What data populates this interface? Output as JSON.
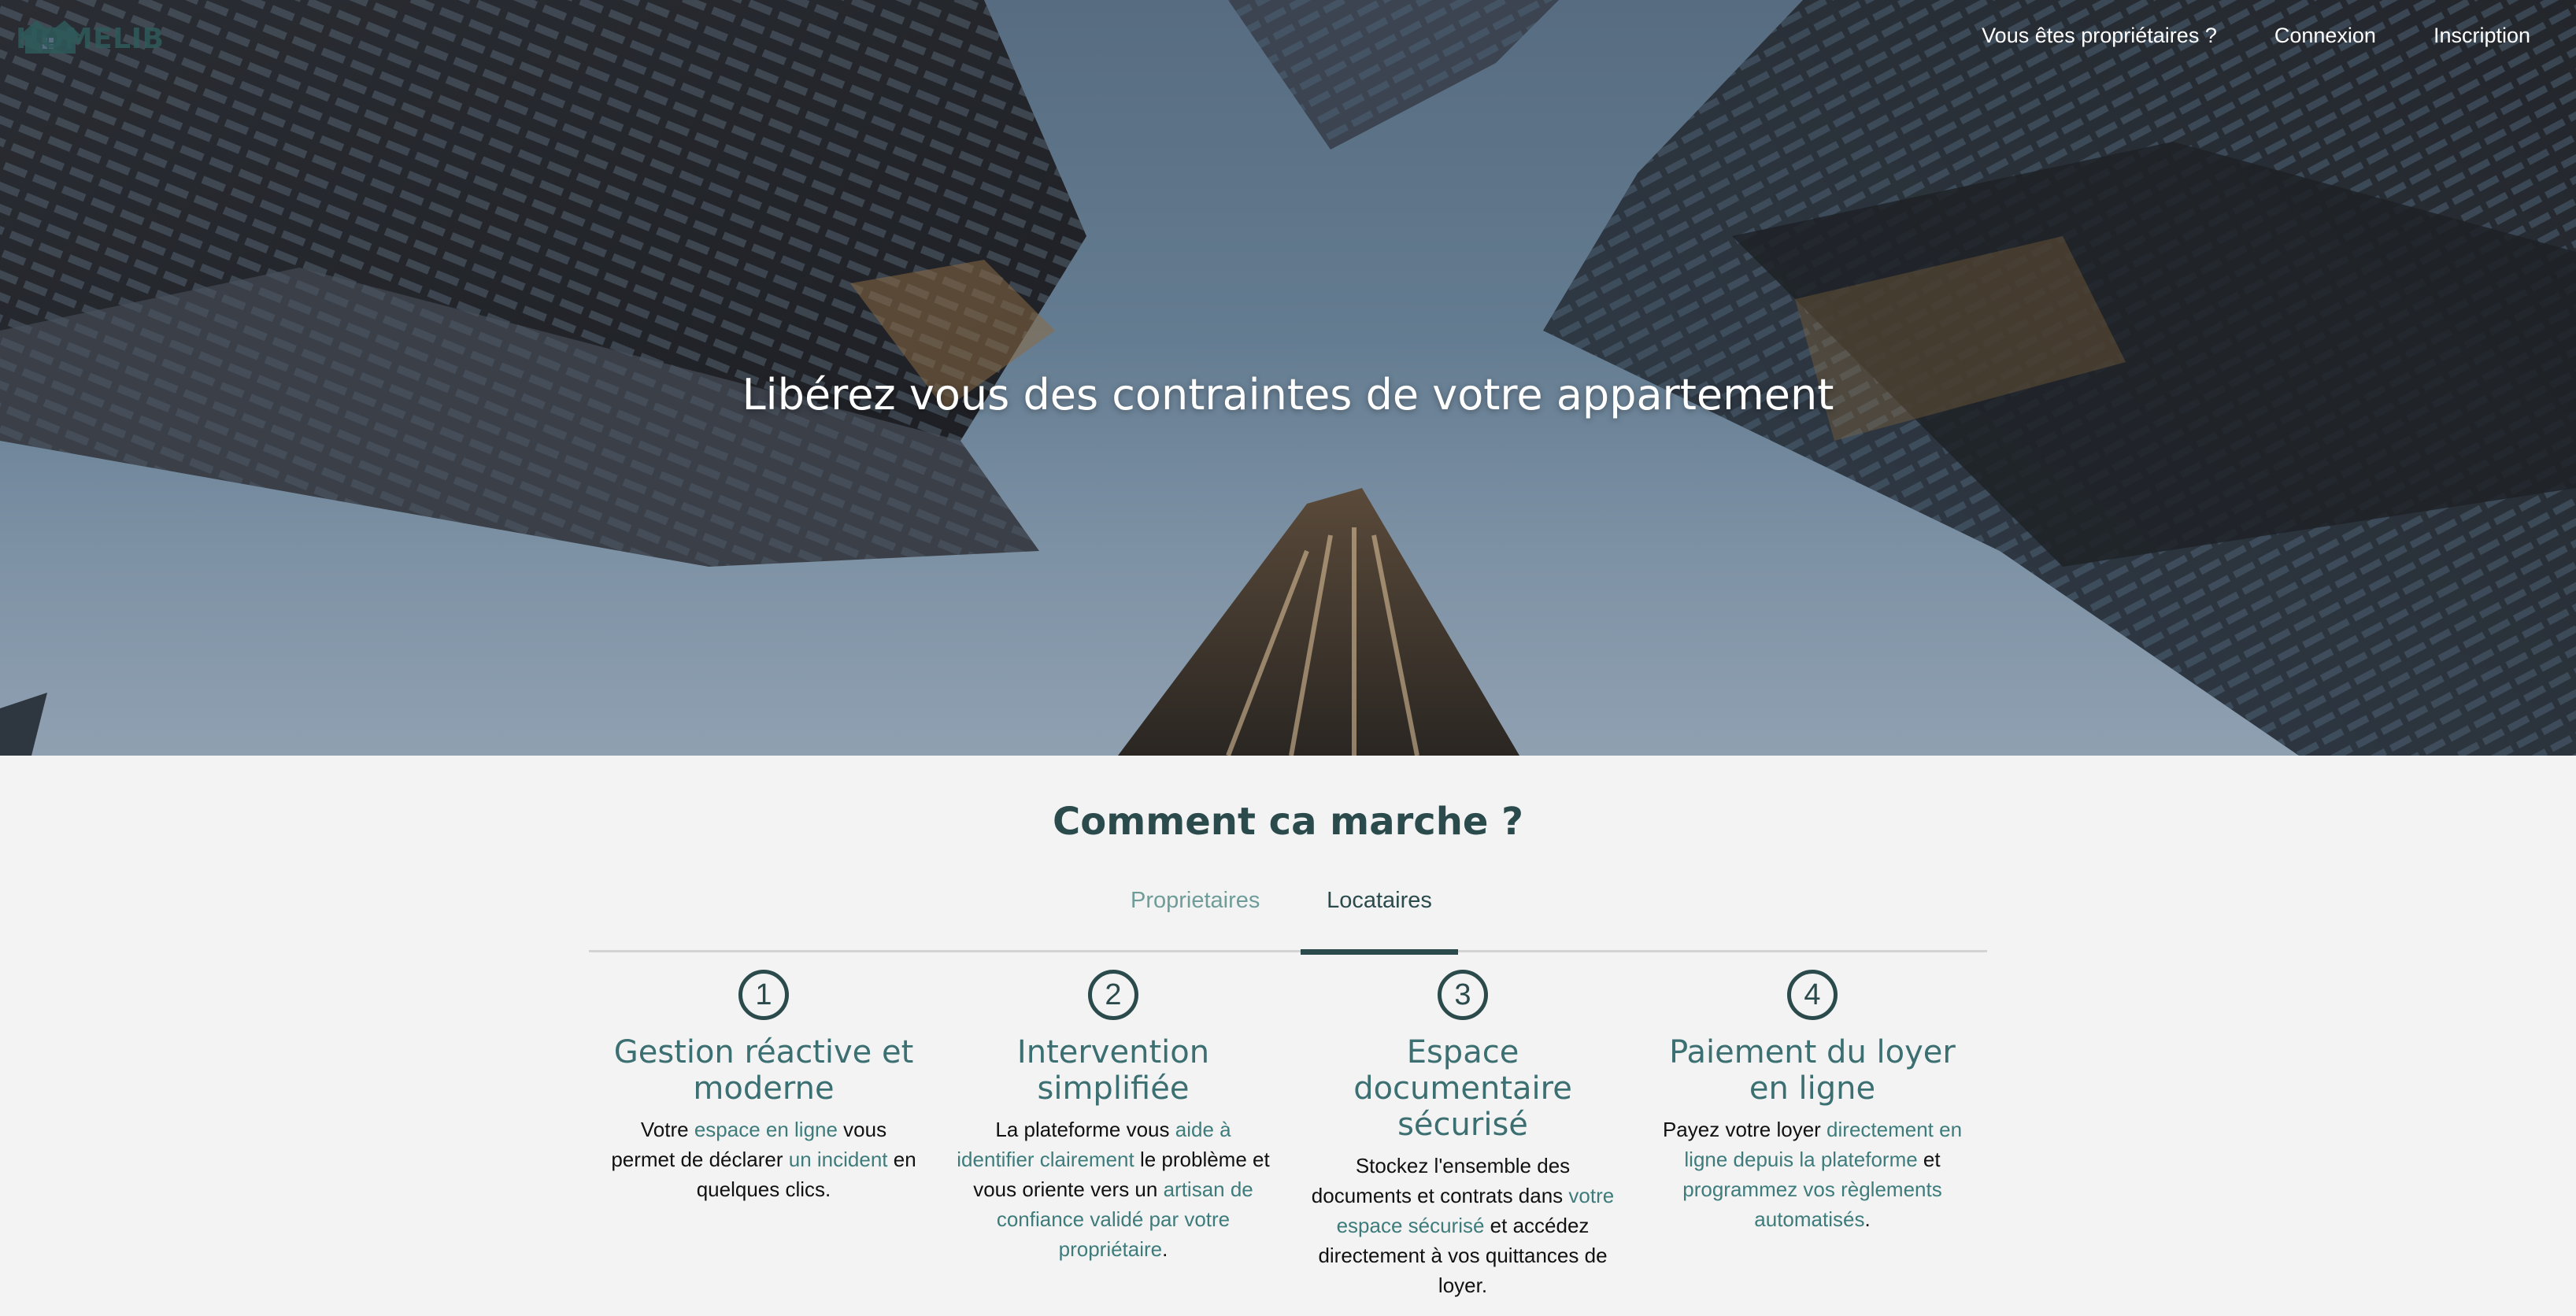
{
  "brand": {
    "name": "HOMELIB"
  },
  "nav": {
    "owners_link": "Vous êtes propriétaires ?",
    "login": "Connexion",
    "signup": "Inscription"
  },
  "hero": {
    "title": "Libérez vous des contraintes de votre appartement"
  },
  "how": {
    "title": "Comment ca marche ?",
    "tabs": [
      {
        "label": "Proprietaires",
        "active": false
      },
      {
        "label": "Locataires",
        "active": true
      }
    ],
    "steps": [
      {
        "number": "1",
        "title": "Gestion réactive et moderne",
        "desc": [
          {
            "t": "Votre "
          },
          {
            "t": "espace en ligne",
            "hl": true
          },
          {
            "t": " vous permet de déclarer "
          },
          {
            "t": "un incident",
            "hl": true
          },
          {
            "t": " en quelques clics."
          }
        ]
      },
      {
        "number": "2",
        "title": "Intervention simplifiée",
        "desc": [
          {
            "t": "La plateforme vous "
          },
          {
            "t": "aide à identifier clairement",
            "hl": true
          },
          {
            "t": " le problème et vous oriente vers un "
          },
          {
            "t": "artisan de confiance validé par votre propriétaire",
            "hl": true
          },
          {
            "t": "."
          }
        ]
      },
      {
        "number": "3",
        "title": "Espace documentaire sécurisé",
        "desc": [
          {
            "t": "Stockez l'ensemble des documents et contrats dans "
          },
          {
            "t": "votre espace sécurisé",
            "hl": true
          },
          {
            "t": " et accédez directement à vos quittances de loyer."
          }
        ]
      },
      {
        "number": "4",
        "title": "Paiement du loyer en ligne",
        "desc": [
          {
            "t": "Payez votre loyer "
          },
          {
            "t": "directement en ligne depuis la plateforme",
            "hl": true
          },
          {
            "t": " et "
          },
          {
            "t": "programmez vos règlements automatisés",
            "hl": true
          },
          {
            "t": "."
          }
        ]
      }
    ]
  },
  "colors": {
    "primary": "#2b4a4b",
    "accent": "#3e7b7b",
    "tab_inactive": "#6e9d99",
    "background": "#f3f3f3"
  },
  "icons": {
    "logo": "house-icon"
  }
}
